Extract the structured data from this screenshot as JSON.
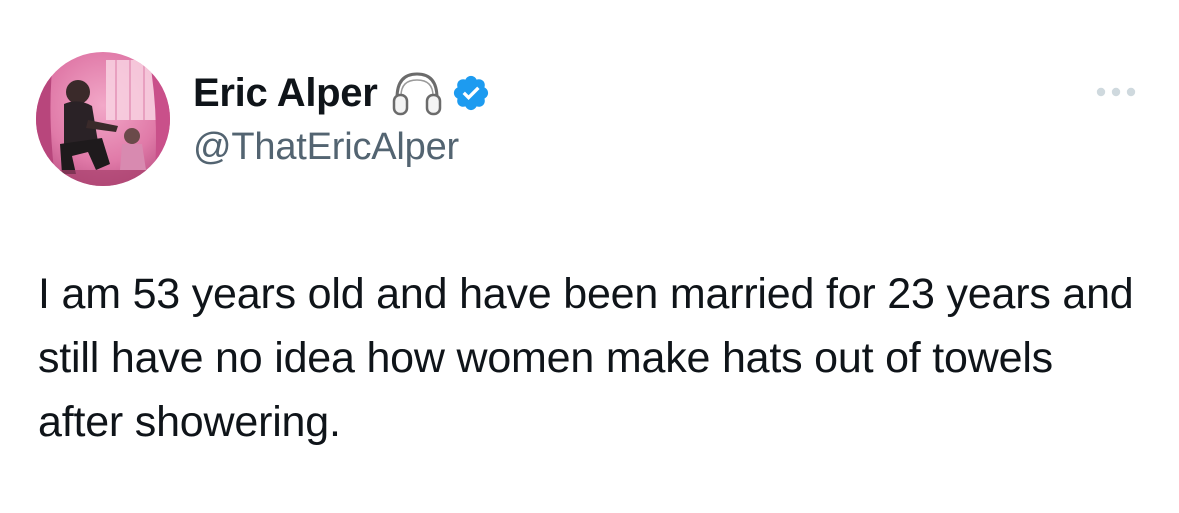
{
  "tweet": {
    "author": {
      "display_name": "Eric Alper",
      "handle": "@ThatEricAlper",
      "avatar_icon": "avatar-photo",
      "badge_icons": [
        "headphones-icon",
        "verified-badge-icon"
      ]
    },
    "more_icon": "more-options-icon",
    "text": "I am 53 years old and have been married for 23 years and still have no idea how women make hats out of towels after showering."
  },
  "colors": {
    "text_primary": "#0f1419",
    "text_secondary": "#536471",
    "verified_blue": "#1d9bf0",
    "avatar_pink": "#e06aa0"
  }
}
